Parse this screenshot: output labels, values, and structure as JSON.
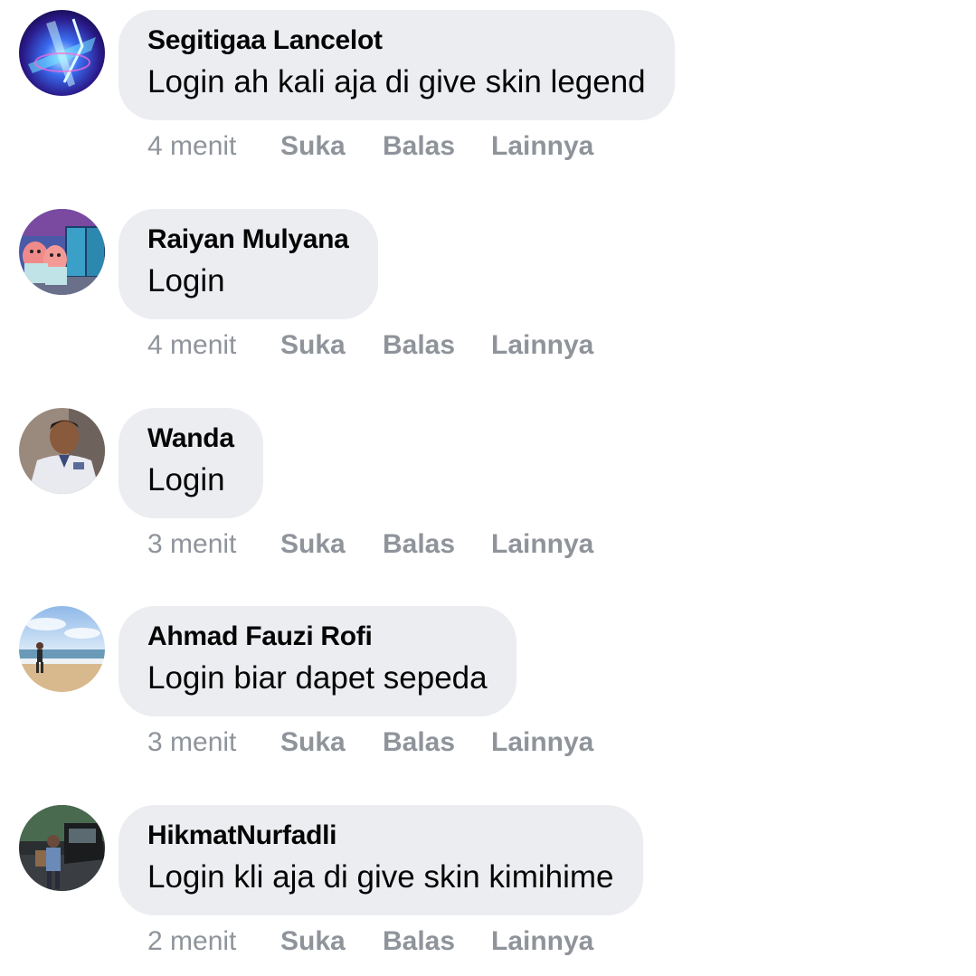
{
  "comments": [
    {
      "author": "Segitigaa Lancelot",
      "text": "Login ah kali aja di give skin legend",
      "time": "4 menit",
      "avatar_icon": "neon-blue-abstract-avatar"
    },
    {
      "author": "Raiyan Mulyana",
      "text": "Login",
      "time": "4 menit",
      "avatar_icon": "cartoon-characters-avatar"
    },
    {
      "author": "Wanda",
      "text": "Login",
      "time": "3 menit",
      "avatar_icon": "person-photo-avatar"
    },
    {
      "author": "Ahmad Fauzi Rofi",
      "text": "Login biar dapet sepeda",
      "time": "3 menit",
      "avatar_icon": "beach-photo-avatar"
    },
    {
      "author": "HikmatNurfadli",
      "text": "Login kli aja di give skin kimihime",
      "time": "2 menit",
      "avatar_icon": "person-car-photo-avatar"
    }
  ],
  "actions": {
    "like_label": "Suka",
    "reply_label": "Balas",
    "more_label": "Lainnya"
  },
  "colors": {
    "bubble_bg": "#ebedf0",
    "text": "#050505",
    "meta": "#8f949b"
  }
}
